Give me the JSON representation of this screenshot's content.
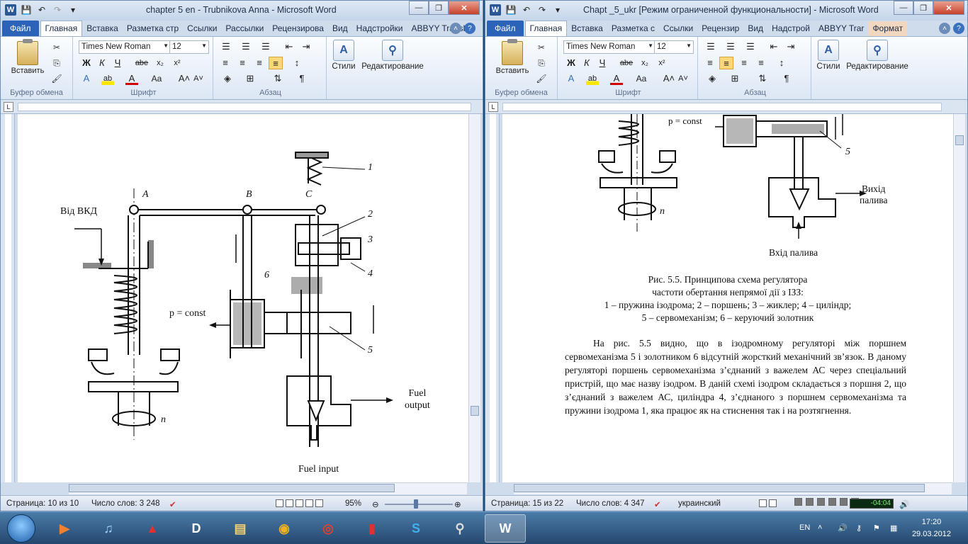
{
  "left_window": {
    "title": "chapter 5 en - Trubnikova Anna  -  Microsoft Word",
    "tabs": [
      "Файл",
      "Главная",
      "Вставка",
      "Разметка стр",
      "Ссылки",
      "Рассылки",
      "Рецензирова",
      "Вид",
      "Надстройки",
      "ABBYY Translа"
    ],
    "ribbon": {
      "paste_label": "Вставить",
      "font_name": "Times New Roman",
      "font_size": "12",
      "group_clipboard": "Буфер обмена",
      "group_font": "Шрифт",
      "group_paragraph": "Абзац",
      "styles_label": "Стили",
      "editing_label": "Редактирование"
    },
    "diagram_labels": {
      "from": "Від ВКД",
      "a": "A",
      "b": "B",
      "c": "C",
      "n1": "1",
      "n2": "2",
      "n3": "3",
      "n4": "4",
      "n5": "5",
      "n6": "6",
      "p_const": "p = const",
      "n": "n",
      "fuel_output": "Fuel\noutput",
      "fuel_input": "Fuel input"
    },
    "status": {
      "page": "Страница: 10 из 10",
      "words": "Число слов: 3 248",
      "zoom": "95%"
    }
  },
  "right_window": {
    "title": "Chapt _5_ukr [Режим ограниченной функциональности]  -  Microsoft Word",
    "tabs": [
      "Файл",
      "Главная",
      "Вставка",
      "Разметка с",
      "Ссылки",
      "Рецензир",
      "Вид",
      "Надстрой",
      "ABBYY Trar",
      "Формат"
    ],
    "ribbon": {
      "paste_label": "Вставить",
      "font_name": "Times New Roman",
      "font_size": "12",
      "group_clipboard": "Буфер обмена",
      "group_font": "Шрифт",
      "group_paragraph": "Абзац",
      "styles_label": "Стили",
      "editing_label": "Редактирование"
    },
    "diagram_labels": {
      "p_const": "p = const",
      "n5": "5",
      "n": "n",
      "fuel_output": "Вихід\nпалива",
      "fuel_input": "Вхід палива"
    },
    "caption": {
      "line1": "Рис. 5.5. Принципова схема регулятора",
      "line2": "частоти обертання непрямої дії з ІЗЗ:",
      "line3": "1 – пружина ізодрома; 2 – поршень; 3 – жиклер; 4 – циліндр;",
      "line4": "5 – сервомеханізм; 6 – керуючий золотник"
    },
    "paragraph": "На рис. 5.5 видно, що в ізодромному регуляторі між поршнем сервомеханізма 5 і золотником 6 відсутній жорсткий механічний зв’язок. В даному регуляторі поршень сервомеханізма з’єднаний з важелем АС через спеціальний пристрій, що має назву ізодром. В даній схемі ізодром складається з поршня 2, що з’єднаний з важелем АС, циліндра 4, з’єднаного з поршнем сервомеханізма та пружини ізодрома 1, яка працює як на стиснення так і на розтягнення.",
    "status": {
      "page": "Страница: 15 из 22",
      "words": "Число слов: 4 347",
      "language": "украинский",
      "media_time": "-04:04"
    }
  },
  "taskbar": {
    "lang": "EN",
    "time": "17:20",
    "date": "29.03.2012"
  }
}
